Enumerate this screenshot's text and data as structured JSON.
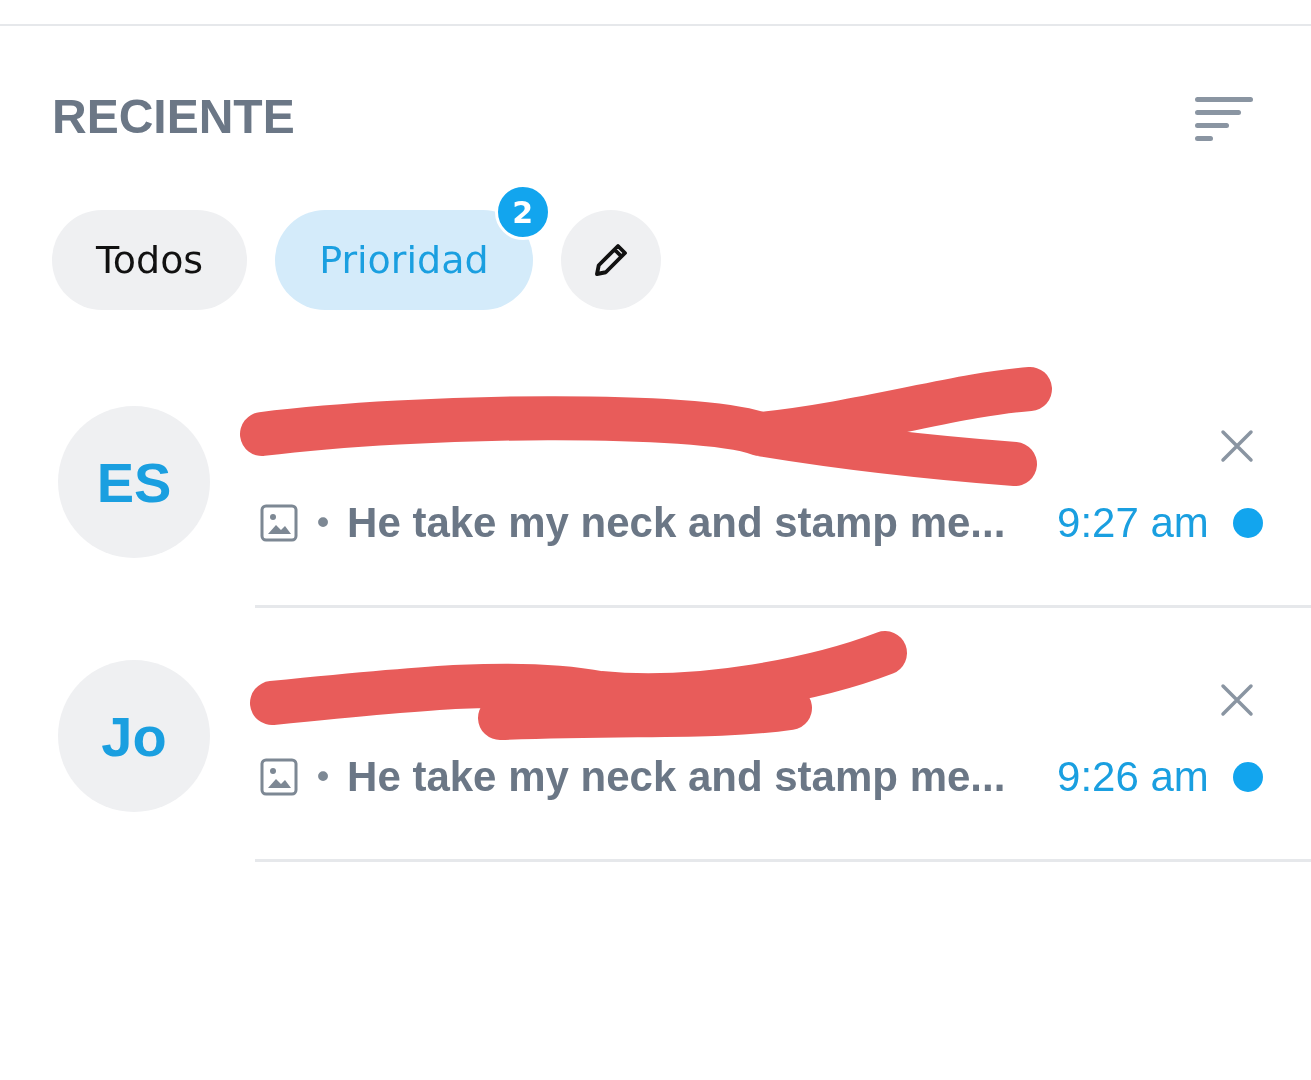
{
  "header": {
    "title": "RECIENTE"
  },
  "filters": [
    {
      "label": "Todos",
      "selected": false
    },
    {
      "label": "Prioridad",
      "selected": true,
      "badge": "2"
    }
  ],
  "chats": [
    {
      "initials": "ES",
      "name_redacted": true,
      "preview_separator": "•",
      "preview": "He take my neck and stamp me...",
      "time": "9:27 am",
      "unread": true
    },
    {
      "initials": "Jo",
      "name_redacted": true,
      "preview_separator": "•",
      "preview": "He take my neck and stamp me...",
      "time": "9:26 am",
      "unread": true
    }
  ]
}
